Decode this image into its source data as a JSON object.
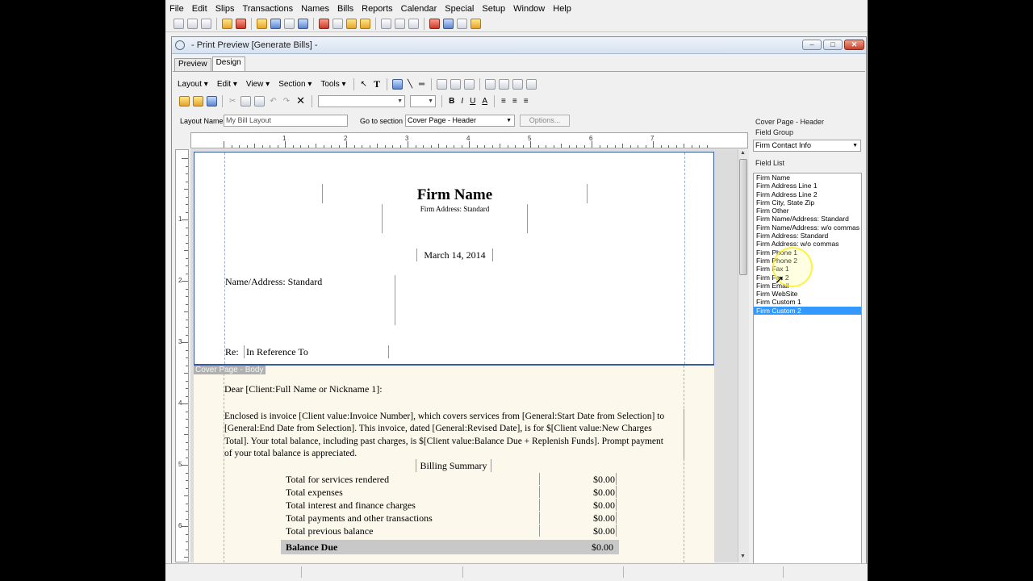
{
  "menu": [
    "File",
    "Edit",
    "Slips",
    "Transactions",
    "Names",
    "Bills",
    "Reports",
    "Calendar",
    "Special",
    "Setup",
    "Window",
    "Help"
  ],
  "window": {
    "title": "- Print Preview [Generate Bills] -"
  },
  "tabs": [
    "Preview",
    "Design"
  ],
  "design_toolbar": {
    "menus": [
      "Layout",
      "Edit",
      "View",
      "Section",
      "Tools"
    ],
    "bold": "B",
    "italic": "I",
    "underline": "U",
    "text_color": "A"
  },
  "layout_row": {
    "layout_name_label": "Layout Name",
    "layout_name_value": "My Bill Layout",
    "go_to_section_label": "Go to section",
    "go_to_section_value": "Cover Page - Header",
    "options_label": "Options..."
  },
  "ruler": {
    "h_numbers": [
      "1",
      "2",
      "3",
      "4",
      "5",
      "6",
      "7"
    ],
    "v_numbers": [
      "1",
      "2",
      "3",
      "4",
      "5",
      "6"
    ]
  },
  "header_section": {
    "firm_name": "Firm Name",
    "firm_address": "Firm Address: Standard",
    "date": "March 14, 2014",
    "name_address": "Name/Address: Standard",
    "re_label": "Re:",
    "in_reference_to": "In Reference To"
  },
  "body_section": {
    "label": "Cover Page - Body",
    "salutation": "Dear [Client:Full Name or Nickname 1]:",
    "paragraph_lines": [
      "Enclosed is invoice [Client value:Invoice Number], which covers services from [General:Start Date from Selection] to",
      "[General:End Date from Selection].  This invoice, dated [General:Revised Date], is for $[Client value:New Charges",
      "Total].  Your total balance, including past charges, is $[Client value:Balance Due + Replenish Funds]. Prompt payment",
      "of your total balance is appreciated."
    ],
    "billing_summary_title": "Billing Summary",
    "summary_rows": [
      {
        "label": "Total for services rendered",
        "value": "$0.00"
      },
      {
        "label": "Total expenses",
        "value": "$0.00"
      },
      {
        "label": "Total interest and finance charges",
        "value": "$0.00"
      },
      {
        "label": "Total payments and other transactions",
        "value": "$0.00"
      },
      {
        "label": "Total previous balance",
        "value": "$0.00"
      }
    ],
    "balance_due_label": "Balance Due",
    "balance_due_value": "$0.00"
  },
  "field_panel": {
    "section_title": "Cover Page - Header",
    "field_group_label": "Field Group",
    "field_group_value": "Firm Contact Info",
    "field_list_label": "Field List",
    "fields": [
      "Firm Name",
      "Firm Address Line 1",
      "Firm Address Line 2",
      "Firm City, State Zip",
      "Firm Other",
      "Firm Name/Address: Standard",
      "Firm Name/Address: w/o commas",
      "Firm Address: Standard",
      "Firm Address: w/o commas",
      "Firm Phone 1",
      "Firm Phone 2",
      "Firm Fax 1",
      "Firm Fax 2",
      "Firm Email",
      "Firm WebSite",
      "Firm Custom 1",
      "Firm Custom 2"
    ],
    "selected_index": 16
  },
  "colors": {
    "selection": "#3399ff",
    "band_border": "#3a5a9a",
    "body_band": "#fcf8ec"
  }
}
